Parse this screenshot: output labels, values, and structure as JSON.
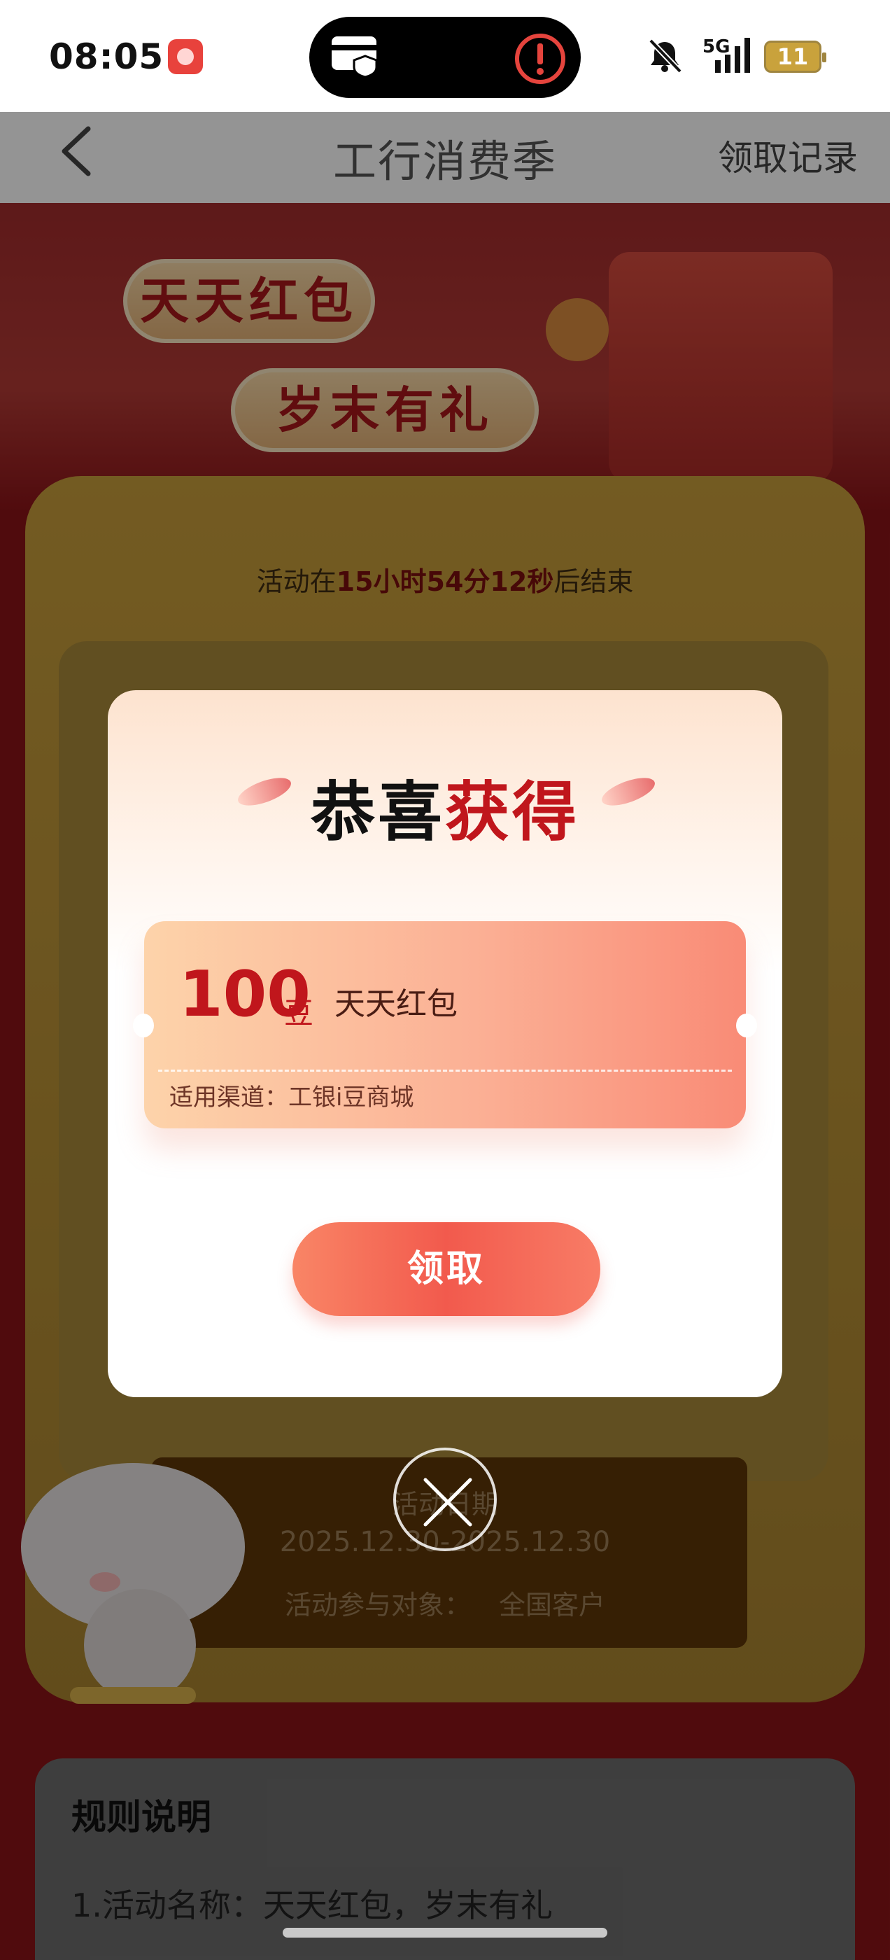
{
  "status_bar": {
    "time": "08:05",
    "network": "5G",
    "battery": "11"
  },
  "nav": {
    "title": "工行消费季",
    "right_action": "领取记录"
  },
  "banner": {
    "tags": [
      "天天红包",
      "岁末有礼"
    ]
  },
  "countdown": {
    "prefix": "活动在",
    "time": "15小时54分12秒",
    "suffix": "后结束"
  },
  "activity": {
    "date_title": "活动日期",
    "date_range": "2025.12.30-2025.12.30",
    "audience_label": "活动参与对象：",
    "audience_value": "全国客户"
  },
  "rules": {
    "title": "规则说明",
    "line1": "1.活动名称：天天红包，岁末有礼"
  },
  "modal": {
    "title_black": "恭喜",
    "title_red": "获得",
    "coupon": {
      "amount": "100",
      "unit": "豆",
      "name": "天天红包",
      "channel": "适用渠道：工银i豆商城"
    },
    "claim_button": "领取"
  },
  "colors": {
    "accent_red": "#c0161c",
    "button_red": "#f25a4d",
    "gold": "#c79d3b"
  }
}
